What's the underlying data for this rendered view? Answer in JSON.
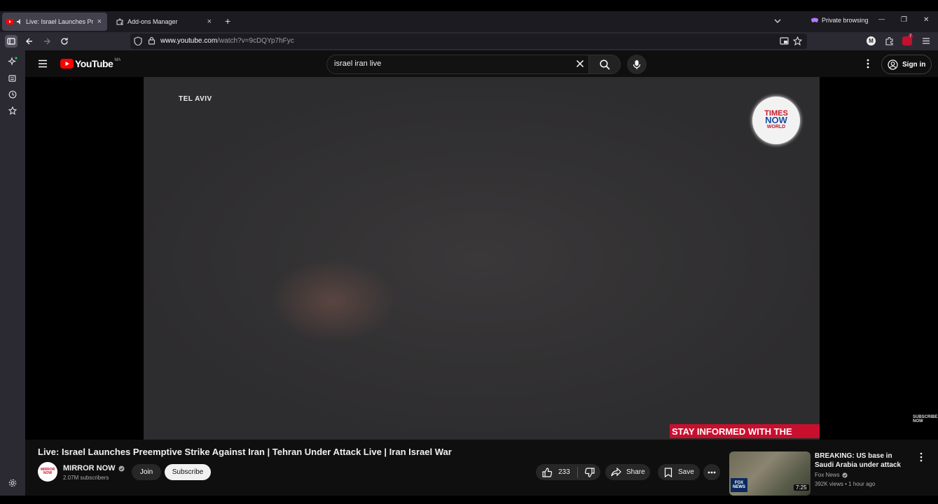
{
  "browser": {
    "tabs": [
      {
        "title": "Live: Israel Launches Preemptive",
        "close": "×"
      },
      {
        "title": "Add-ons Manager",
        "close": "×"
      }
    ],
    "new_tab": "+",
    "private_label": "Private browsing",
    "window_controls": {
      "minimize": "—",
      "restore": "❐",
      "close": "✕"
    },
    "url_host": "www.youtube.com",
    "url_path": "/watch?v=9cDQYp7hFyc",
    "extension_badge": "7"
  },
  "youtube": {
    "logo_text": "YouTube",
    "country_code": "MA",
    "search_value": "israel iran live",
    "sign_in": "Sign in"
  },
  "video": {
    "overlay_location": "TEL AVIV",
    "logo_lines": [
      "TIMES",
      "NOW",
      "WORLD"
    ],
    "ticker_text": "STAY INFORMED WITH THE",
    "watermark": "SUBSCRIBE NOW",
    "title": "Live: Israel Launches Preemptive Strike Against Iran | Tehran Under Attack Live | Iran Israel War"
  },
  "channel": {
    "name": "MIRROR NOW",
    "subscribers": "2.07M subscribers",
    "join": "Join",
    "subscribe": "Subscribe",
    "avatar_text": "MIRROR NOW"
  },
  "actions": {
    "likes": "233",
    "share": "Share",
    "save": "Save"
  },
  "recommendation": {
    "title": "BREAKING: US base in Saudi Arabia under attack",
    "channel": "Fox News",
    "meta": "392K views • 1 hour ago",
    "duration": "7:25",
    "logo": "FOX NEWS"
  }
}
